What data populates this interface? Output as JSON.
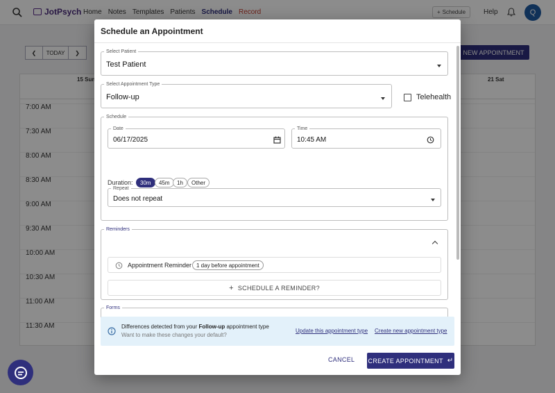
{
  "nav": {
    "brand": "JotPsych",
    "links": [
      "Home",
      "Notes",
      "Templates",
      "Patients",
      "Schedule",
      "Record"
    ],
    "schedule_button": "Schedule",
    "help": "Help",
    "avatar_initial": "Q"
  },
  "calendar": {
    "today_button": "TODAY",
    "new_appointment_button": "NEW APPOINTMENT",
    "first_day": "15 Sun",
    "last_day": "21 Sat",
    "times": [
      "7:00 AM",
      "7:30 AM",
      "8:00 AM",
      "8:30 AM",
      "9:00 AM",
      "9:30 AM",
      "10:00 AM",
      "10:30 AM",
      "11:00 AM",
      "11:30 AM"
    ]
  },
  "modal": {
    "title": "Schedule an Appointment",
    "patient": {
      "label": "Select Patient",
      "value": "Test Patient"
    },
    "appointment_type": {
      "label": "Select Appointment Type",
      "value": "Follow-up"
    },
    "telehealth": {
      "label": "Telehealth",
      "checked": false
    },
    "schedule": {
      "legend": "Schedule",
      "date": {
        "label": "Date",
        "value": "06/17/2025"
      },
      "time": {
        "label": "Time",
        "value": "10:45 AM"
      },
      "duration_label": "Duration:",
      "durations": [
        {
          "label": "30m",
          "selected": true
        },
        {
          "label": "45m",
          "selected": false
        },
        {
          "label": "1h",
          "selected": false
        },
        {
          "label": "Other",
          "selected": false
        }
      ],
      "repeat": {
        "label": "Repeat",
        "value": "Does not repeat"
      }
    },
    "reminders": {
      "legend": "Reminders",
      "item_label": "Appointment Reminder",
      "item_timing": "1 day before appointment",
      "add_button": "SCHEDULE A REMINDER?"
    },
    "forms": {
      "legend": "Forms"
    },
    "info": {
      "prefix": "Differences detected from your ",
      "type_name": "Follow-up",
      "suffix": " appointment type",
      "subtext": "Want to make these changes your default?",
      "update_link": "Update this appointment type",
      "create_link": "Create new appointment type"
    },
    "cancel_button": "CANCEL",
    "create_button": "CREATE APPOINTMENT"
  },
  "colors": {
    "primary": "#2f2f7c",
    "info_bg": "#e3f1fa",
    "legend_accent": "#2f2f7c"
  }
}
